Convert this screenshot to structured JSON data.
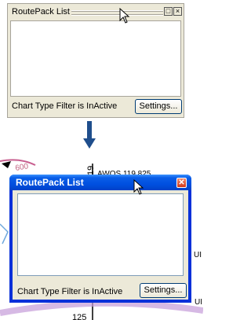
{
  "top_panel": {
    "title": "RoutePack List",
    "restore_glyph": "□",
    "close_glyph": "×",
    "status": "Chart Type Filter is InActive",
    "settings_label": "Settings..."
  },
  "arrow": {
    "icon": "arrow-down-icon",
    "color": "#1f4e8c"
  },
  "map": {
    "labels": {
      "heading_600": "600",
      "awos": "AWOS 119.825",
      "runway_19": "19",
      "ui_1": "UI",
      "ui_2": "UI",
      "heading_125": "125"
    }
  },
  "floating_window": {
    "title": "RoutePack List",
    "close_glyph": "✕",
    "status": "Chart Type Filter is InActive",
    "settings_label": "Settings...",
    "title_color": "#0054e3"
  },
  "cursors": {
    "icon": "mouse-pointer-icon"
  }
}
